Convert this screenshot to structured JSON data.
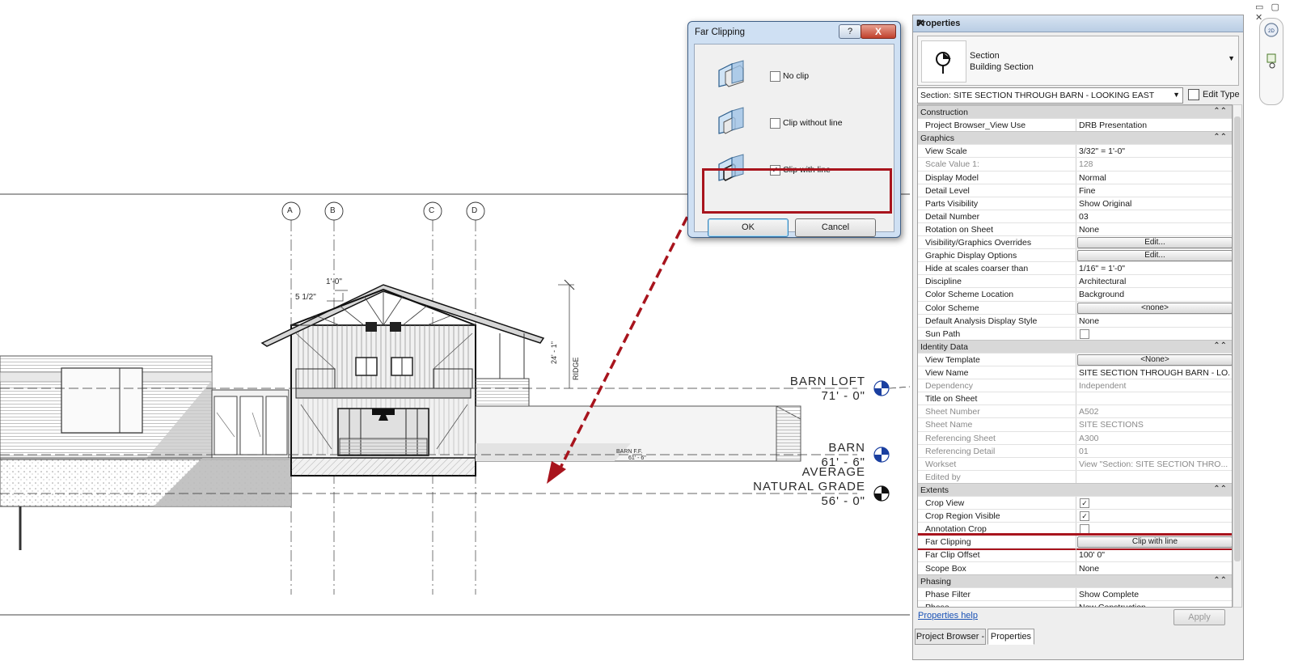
{
  "drawing": {
    "grid_labels": [
      "A",
      "B",
      "C",
      "D"
    ],
    "dim_top": "1'-0\"",
    "dim_slope": "5 1/2\"",
    "dim_height": "24' - 1\"",
    "ridge_label": "RIDGE",
    "barn_ff_name": "BARN F.F.",
    "barn_ff_elev": "61' - 6\"",
    "levels": [
      {
        "name": "BARN LOFT",
        "elev": "71' - 0\""
      },
      {
        "name": "BARN",
        "elev": "61' - 6\""
      },
      {
        "name": "AVERAGE\nNATURAL GRADE",
        "elev": "56' - 0\""
      }
    ],
    "accent_color": "#a8141d"
  },
  "dialog": {
    "title": "Far Clipping",
    "help_label": "?",
    "close_label": "X",
    "options": [
      {
        "label": "No clip",
        "checked": false,
        "check_glyph": ""
      },
      {
        "label": "Clip without line",
        "checked": false,
        "check_glyph": ""
      },
      {
        "label": "Clip with line",
        "checked": true,
        "check_glyph": "✓"
      }
    ],
    "ok_label": "OK",
    "cancel_label": "Cancel"
  },
  "properties": {
    "title": "Properties",
    "close_label": "✕",
    "type_category": "Section",
    "type_name": "Building Section",
    "instance_selector": "Section: SITE SECTION THROUGH BARN - LOOKING EAST",
    "edit_type_label": "Edit Type",
    "groups": [
      {
        "name": "Construction",
        "rows": [
          {
            "name": "Project Browser_View Use",
            "value": "DRB Presentation",
            "kind": "text"
          }
        ]
      },
      {
        "name": "Graphics",
        "rows": [
          {
            "name": "View Scale",
            "value": " 3/32\" = 1'-0\"",
            "kind": "text"
          },
          {
            "name": "Scale Value    1:",
            "value": "128",
            "kind": "readonly"
          },
          {
            "name": "Display Model",
            "value": "Normal",
            "kind": "text"
          },
          {
            "name": "Detail Level",
            "value": "Fine",
            "kind": "text"
          },
          {
            "name": "Parts Visibility",
            "value": "Show Original",
            "kind": "text"
          },
          {
            "name": "Detail Number",
            "value": "03",
            "kind": "text"
          },
          {
            "name": "Rotation on Sheet",
            "value": "None",
            "kind": "text"
          },
          {
            "name": "Visibility/Graphics Overrides",
            "value": "Edit...",
            "kind": "button"
          },
          {
            "name": "Graphic Display Options",
            "value": "Edit...",
            "kind": "button"
          },
          {
            "name": "Hide at scales coarser than",
            "value": " 1/16\" = 1'-0\"",
            "kind": "text"
          },
          {
            "name": "Discipline",
            "value": "Architectural",
            "kind": "text"
          },
          {
            "name": "Color Scheme Location",
            "value": "Background",
            "kind": "text"
          },
          {
            "name": "Color Scheme",
            "value": "<none>",
            "kind": "button"
          },
          {
            "name": "Default Analysis Display Style",
            "value": "None",
            "kind": "text"
          },
          {
            "name": "Sun Path",
            "value": "",
            "kind": "checkbox"
          }
        ]
      },
      {
        "name": "Identity Data",
        "rows": [
          {
            "name": "View Template",
            "value": "<None>",
            "kind": "button"
          },
          {
            "name": "View Name",
            "value": "SITE SECTION THROUGH BARN - LO...",
            "kind": "text"
          },
          {
            "name": "Dependency",
            "value": "Independent",
            "kind": "readonly"
          },
          {
            "name": "Title on Sheet",
            "value": "",
            "kind": "text"
          },
          {
            "name": "Sheet Number",
            "value": "A502",
            "kind": "readonly"
          },
          {
            "name": "Sheet Name",
            "value": "SITE SECTIONS",
            "kind": "readonly"
          },
          {
            "name": "Referencing Sheet",
            "value": "A300",
            "kind": "readonly"
          },
          {
            "name": "Referencing Detail",
            "value": "01",
            "kind": "readonly"
          },
          {
            "name": "Workset",
            "value": "View \"Section: SITE SECTION THRO...",
            "kind": "readonly"
          },
          {
            "name": "Edited by",
            "value": "",
            "kind": "readonly"
          }
        ]
      },
      {
        "name": "Extents",
        "rows": [
          {
            "name": "Crop View",
            "value": "✓",
            "kind": "checkbox"
          },
          {
            "name": "Crop Region Visible",
            "value": "✓",
            "kind": "checkbox"
          },
          {
            "name": "Annotation Crop",
            "value": "",
            "kind": "checkbox"
          },
          {
            "name": "Far Clipping",
            "value": "Clip with line",
            "kind": "button"
          },
          {
            "name": "Far Clip Offset",
            "value": "100'  0\"",
            "kind": "text"
          },
          {
            "name": "Scope Box",
            "value": "None",
            "kind": "text"
          }
        ]
      },
      {
        "name": "Phasing",
        "rows": [
          {
            "name": "Phase Filter",
            "value": "Show Complete",
            "kind": "text"
          },
          {
            "name": "Phase",
            "value": "New Construction",
            "kind": "text"
          }
        ]
      }
    ],
    "help_link": "Properties help",
    "apply_label": "Apply",
    "tabs": [
      "Project Browser -",
      "Properties"
    ]
  },
  "window_controls": "▭ ▢ ✕"
}
